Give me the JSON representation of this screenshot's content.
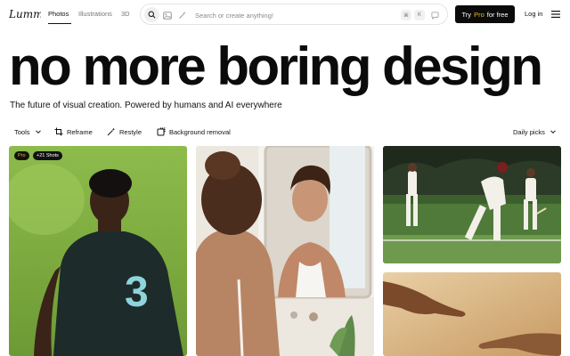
{
  "brand": {
    "logo_text": "Lummi"
  },
  "nav": {
    "tabs": [
      {
        "label": "Photos",
        "active": true
      },
      {
        "label": "Illustrations",
        "active": false
      },
      {
        "label": "3D",
        "active": false
      }
    ]
  },
  "search": {
    "placeholder": "Search or create anything!",
    "value": "",
    "shortcut_keys": [
      "⌘",
      "K"
    ]
  },
  "header_actions": {
    "try_label": "Try",
    "pro_label": "Pro",
    "for_free_label": "for free",
    "login_label": "Log in"
  },
  "hero": {
    "title": "no more boring design",
    "subtitle": "The future of visual creation. Powered by humans and AI everywhere"
  },
  "toolbar": {
    "tools_label": "Tools",
    "reframe_label": "Reframe",
    "restyle_label": "Restyle",
    "bg_removal_label": "Background removal",
    "sort_label": "Daily picks"
  },
  "gallery": {
    "cards": [
      {
        "name": "soccer-player",
        "badges": [
          "Pro",
          "+21 Shots"
        ]
      },
      {
        "name": "woman-mirror",
        "badges": []
      },
      {
        "name": "cricket-match",
        "badges": []
      },
      {
        "name": "reaching-hands",
        "badges": []
      }
    ]
  },
  "colors": {
    "accent_pro": "#f5b326",
    "button_dark": "#0b0b0b"
  }
}
